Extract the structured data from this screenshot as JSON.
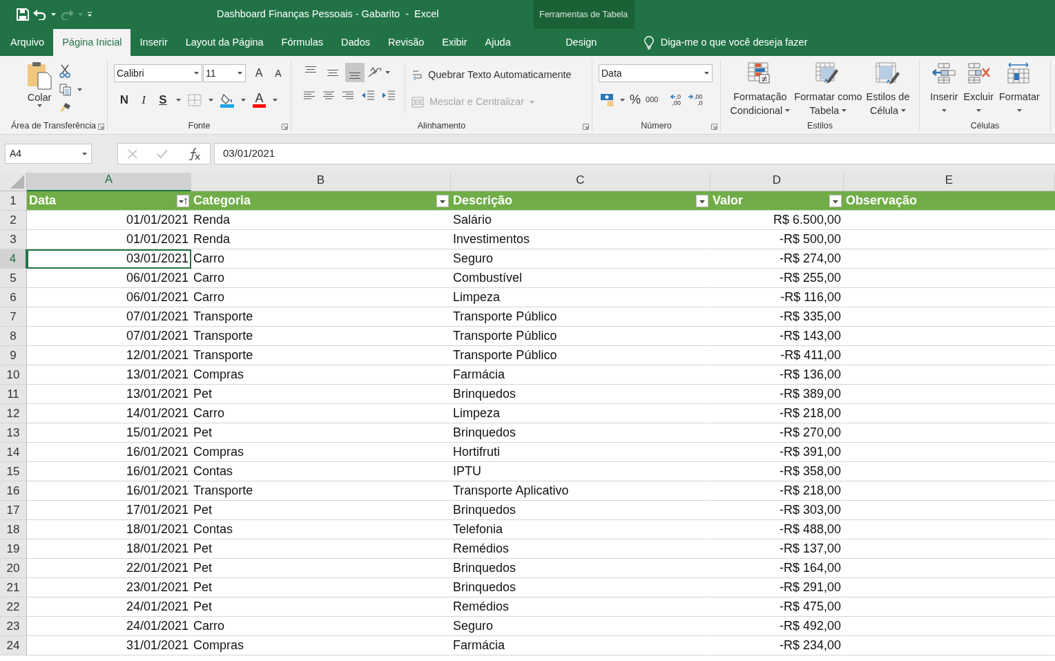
{
  "title_bar": {
    "title": "Dashboard Finanças Pessoais - Gabarito  -  Excel",
    "context_label": "Ferramentas de Tabela"
  },
  "tabs": [
    {
      "label": "Arquivo",
      "selected": false,
      "kind": "normal"
    },
    {
      "label": "Página Inicial",
      "selected": true,
      "kind": "normal"
    },
    {
      "label": "Inserir",
      "selected": false,
      "kind": "normal"
    },
    {
      "label": "Layout da Página",
      "selected": false,
      "kind": "normal"
    },
    {
      "label": "Fórmulas",
      "selected": false,
      "kind": "normal"
    },
    {
      "label": "Dados",
      "selected": false,
      "kind": "normal"
    },
    {
      "label": "Revisão",
      "selected": false,
      "kind": "normal"
    },
    {
      "label": "Exibir",
      "selected": false,
      "kind": "normal"
    },
    {
      "label": "Ajuda",
      "selected": false,
      "kind": "normal"
    },
    {
      "label": "Design",
      "selected": false,
      "kind": "contextual"
    }
  ],
  "tell_me": {
    "placeholder": "Diga-me o que você deseja fazer"
  },
  "ribbon": {
    "clipboard": {
      "paste": "Colar",
      "label": "Área de Transferência"
    },
    "font": {
      "name": "Calibri",
      "size": "11",
      "grow": "A",
      "shrink": "A",
      "styles": [
        "N",
        "I",
        "S"
      ],
      "color_letter": "A",
      "label": "Fonte"
    },
    "alignment": {
      "vertical": [
        {
          "selected": false
        },
        {
          "selected": false
        },
        {
          "selected": true
        }
      ],
      "wrap": "Quebrar Texto Automaticamente",
      "merge": {
        "label": "Mesclar e Centralizar",
        "disabled": true
      },
      "label": "Alinhamento"
    },
    "number": {
      "format": "Data",
      "percent": "%",
      "thousands": "000",
      "decimals": [
        {
          "top": ",0",
          "bottom": ",00"
        },
        {
          "top": ",00",
          "bottom": ",0"
        }
      ],
      "label": "Número"
    },
    "styles": {
      "buttons": [
        {
          "lines": [
            "Formatação",
            "Condicional"
          ],
          "dropdown": true
        },
        {
          "lines": [
            "Formatar como",
            "Tabela"
          ],
          "dropdown": true
        },
        {
          "lines": [
            "Estilos de",
            "Célula"
          ],
          "dropdown": true
        }
      ],
      "label": "Estilos"
    },
    "cells": {
      "buttons": [
        "Inserir",
        "Excluir",
        "Formatar"
      ],
      "label": "Células"
    }
  },
  "formula_bar": {
    "name_box": "A4",
    "formula": "03/01/2021"
  },
  "sheet": {
    "columns": [
      {
        "letter": "A",
        "selected": true
      },
      {
        "letter": "B",
        "selected": false
      },
      {
        "letter": "C",
        "selected": false
      },
      {
        "letter": "D",
        "selected": false
      },
      {
        "letter": "E",
        "selected": false
      }
    ],
    "header_row_number": "1",
    "table_headers": [
      {
        "text": "Data",
        "kind": "sorted"
      },
      {
        "text": "Categoria",
        "kind": "dropdown"
      },
      {
        "text": "Descrição",
        "kind": "dropdown"
      },
      {
        "text": "Valor",
        "kind": "dropdown"
      },
      {
        "text": "Observação",
        "kind": "plain"
      }
    ],
    "rows": [
      {
        "number": "2",
        "date": "01/01/2021",
        "category": "Renda",
        "description": "Salário",
        "value": "R$ 6.500,00",
        "selected": false
      },
      {
        "number": "3",
        "date": "01/01/2021",
        "category": "Renda",
        "description": "Investimentos",
        "value": "-R$ 500,00",
        "selected": false
      },
      {
        "number": "4",
        "date": "03/01/2021",
        "category": "Carro",
        "description": "Seguro",
        "value": "-R$ 274,00",
        "selected": true
      },
      {
        "number": "5",
        "date": "06/01/2021",
        "category": "Carro",
        "description": "Combustível",
        "value": "-R$ 255,00",
        "selected": false
      },
      {
        "number": "6",
        "date": "06/01/2021",
        "category": "Carro",
        "description": "Limpeza",
        "value": "-R$ 116,00",
        "selected": false
      },
      {
        "number": "7",
        "date": "07/01/2021",
        "category": "Transporte",
        "description": "Transporte Público",
        "value": "-R$ 335,00",
        "selected": false
      },
      {
        "number": "8",
        "date": "07/01/2021",
        "category": "Transporte",
        "description": "Transporte Público",
        "value": "-R$ 143,00",
        "selected": false
      },
      {
        "number": "9",
        "date": "12/01/2021",
        "category": "Transporte",
        "description": "Transporte Público",
        "value": "-R$ 411,00",
        "selected": false
      },
      {
        "number": "10",
        "date": "13/01/2021",
        "category": "Compras",
        "description": "Farmácia",
        "value": "-R$ 136,00",
        "selected": false
      },
      {
        "number": "11",
        "date": "13/01/2021",
        "category": "Pet",
        "description": "Brinquedos",
        "value": "-R$ 389,00",
        "selected": false
      },
      {
        "number": "12",
        "date": "14/01/2021",
        "category": "Carro",
        "description": "Limpeza",
        "value": "-R$ 218,00",
        "selected": false
      },
      {
        "number": "13",
        "date": "15/01/2021",
        "category": "Pet",
        "description": "Brinquedos",
        "value": "-R$ 270,00",
        "selected": false
      },
      {
        "number": "14",
        "date": "16/01/2021",
        "category": "Compras",
        "description": "Hortifruti",
        "value": "-R$ 391,00",
        "selected": false
      },
      {
        "number": "15",
        "date": "16/01/2021",
        "category": "Contas",
        "description": "IPTU",
        "value": "-R$ 358,00",
        "selected": false
      },
      {
        "number": "16",
        "date": "16/01/2021",
        "category": "Transporte",
        "description": "Transporte Aplicativo",
        "value": "-R$ 218,00",
        "selected": false
      },
      {
        "number": "17",
        "date": "17/01/2021",
        "category": "Pet",
        "description": "Brinquedos",
        "value": "-R$ 303,00",
        "selected": false
      },
      {
        "number": "18",
        "date": "18/01/2021",
        "category": "Contas",
        "description": "Telefonia",
        "value": "-R$ 488,00",
        "selected": false
      },
      {
        "number": "19",
        "date": "18/01/2021",
        "category": "Pet",
        "description": "Remédios",
        "value": "-R$ 137,00",
        "selected": false
      },
      {
        "number": "20",
        "date": "22/01/2021",
        "category": "Pet",
        "description": "Brinquedos",
        "value": "-R$ 164,00",
        "selected": false
      },
      {
        "number": "21",
        "date": "23/01/2021",
        "category": "Pet",
        "description": "Brinquedos",
        "value": "-R$ 291,00",
        "selected": false
      },
      {
        "number": "22",
        "date": "24/01/2021",
        "category": "Pet",
        "description": "Remédios",
        "value": "-R$ 475,00",
        "selected": false
      },
      {
        "number": "23",
        "date": "24/01/2021",
        "category": "Carro",
        "description": "Seguro",
        "value": "-R$ 492,00",
        "selected": false
      },
      {
        "number": "24",
        "date": "31/01/2021",
        "category": "Compras",
        "description": "Farmácia",
        "value": "-R$ 234,00",
        "selected": false
      }
    ]
  }
}
